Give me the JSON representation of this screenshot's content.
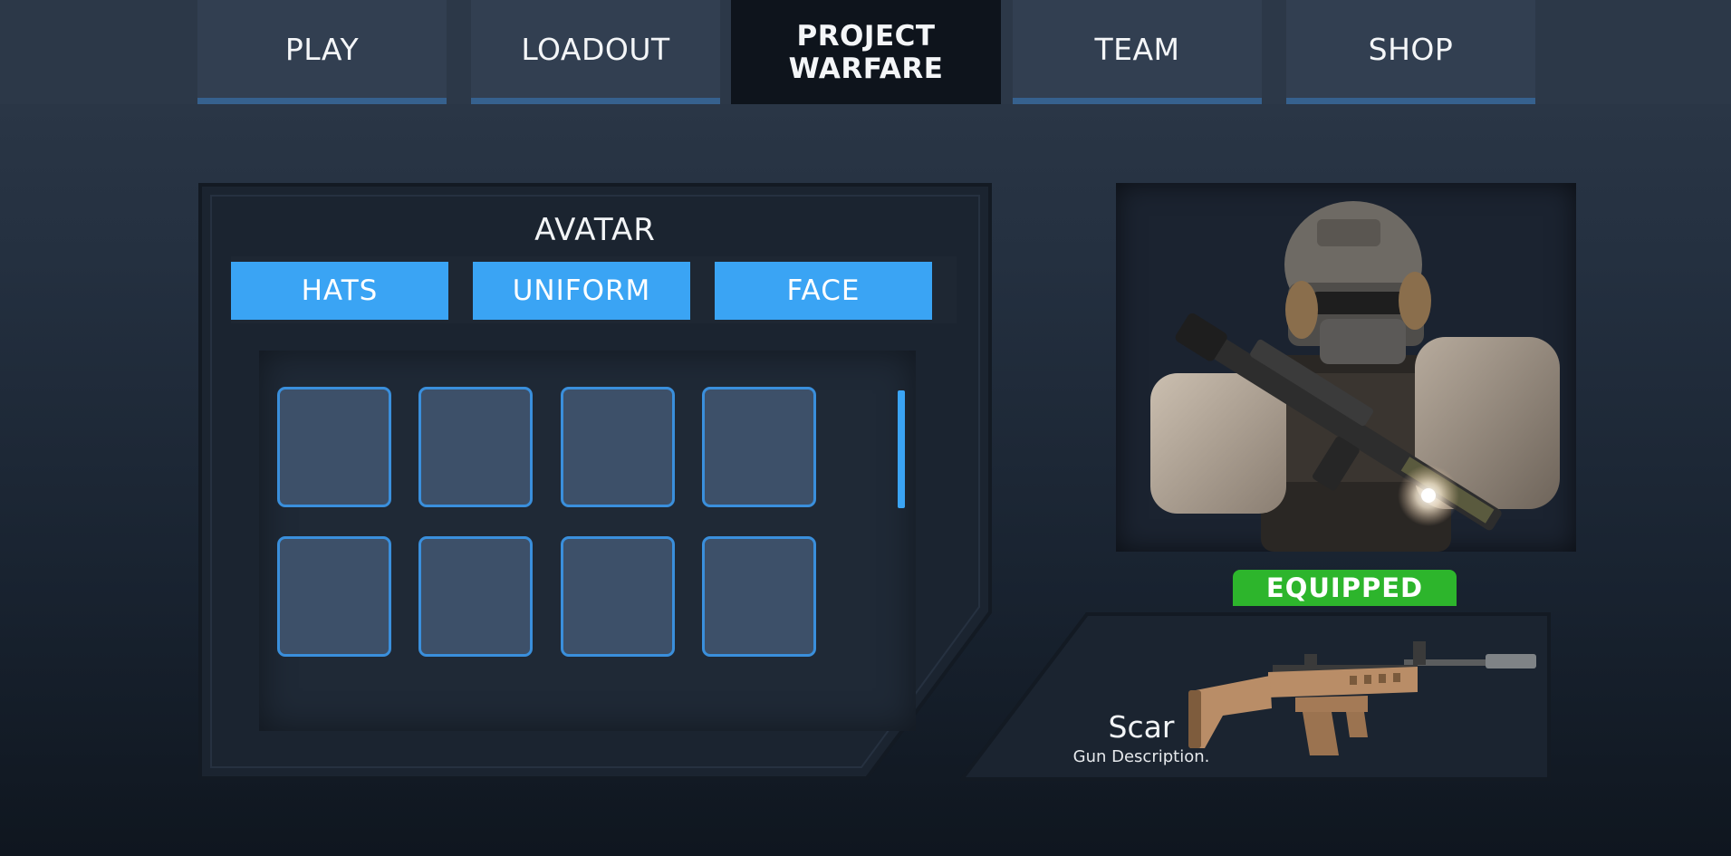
{
  "nav": {
    "tabs": [
      {
        "label": "PLAY"
      },
      {
        "label": "LOADOUT"
      },
      {
        "label": "TEAM"
      },
      {
        "label": "SHOP"
      }
    ],
    "brand": {
      "line1": "PROJECT",
      "line2": "WARFARE"
    }
  },
  "avatar": {
    "title": "AVATAR",
    "categories": [
      {
        "label": "HATS"
      },
      {
        "label": "UNIFORM"
      },
      {
        "label": "FACE"
      }
    ],
    "slot_count": 8
  },
  "character": {
    "status": "EQUIPPED"
  },
  "weapon": {
    "name": "Scar",
    "description": "Gun Description."
  },
  "colors": {
    "accent_blue": "#3aa4f4",
    "equipped_green": "#2db52c",
    "brand_tab": "#0e141c"
  }
}
